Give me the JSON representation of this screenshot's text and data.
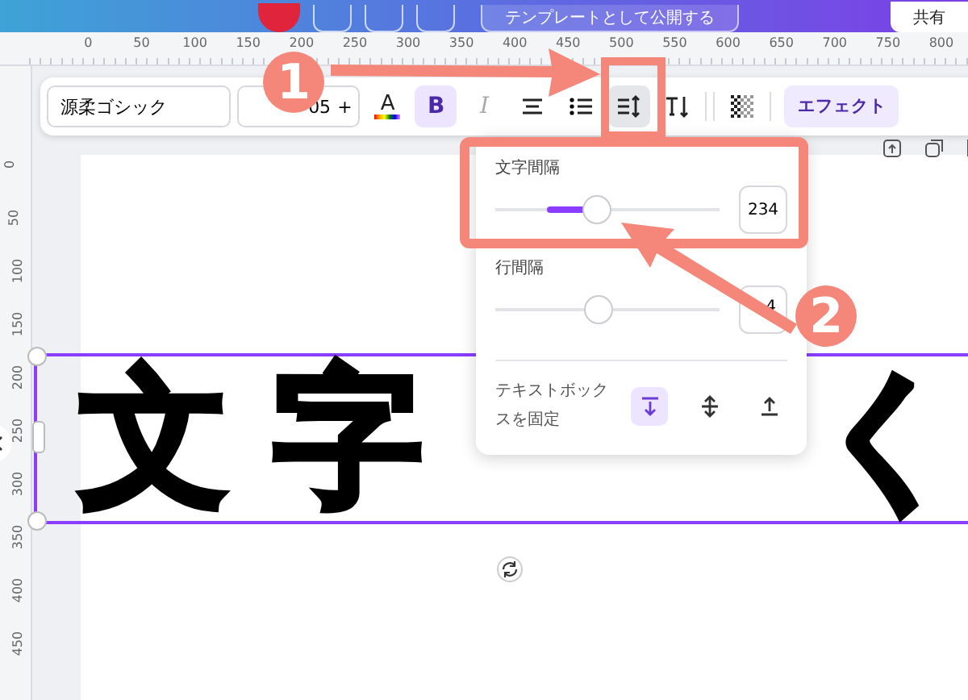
{
  "header": {
    "publish_button": "テンプレートとして公開する",
    "share_button": "共有"
  },
  "ruler": {
    "horizontal": [
      "0",
      "50",
      "100",
      "150",
      "200",
      "250",
      "300",
      "350",
      "400",
      "450",
      "500",
      "550",
      "600",
      "650",
      "700",
      "750",
      "800"
    ],
    "vertical": [
      "0",
      "50",
      "100",
      "150",
      "200",
      "250",
      "300",
      "350",
      "400",
      "450"
    ]
  },
  "toolbar": {
    "font": "源柔ゴシック",
    "font_size": "05",
    "size_plus": "+",
    "tools": [
      {
        "kind": "text-color",
        "label": "A",
        "selected": false
      },
      {
        "kind": "bold",
        "label": "B",
        "selected": true
      },
      {
        "kind": "italic",
        "label": "I",
        "selected": false
      },
      {
        "kind": "align",
        "selected": false
      },
      {
        "kind": "list",
        "selected": false
      },
      {
        "kind": "spacing",
        "selected": true
      },
      {
        "kind": "vertical",
        "selected": false
      },
      {
        "kind": "transparency",
        "selected": false
      }
    ],
    "effect_button": "エフェクト"
  },
  "spacing_panel": {
    "sliders": [
      {
        "label": "文字間隔",
        "level": 0.45,
        "changed": true,
        "value": "234"
      },
      {
        "label": "行間隔",
        "level": 0.46,
        "changed": false,
        "value": "4"
      }
    ],
    "anchor_label": "テキストボックスを固定",
    "anchors": [
      {
        "kind": "top",
        "selected": true
      },
      {
        "kind": "middle",
        "selected": false
      },
      {
        "kind": "bottom",
        "selected": false
      }
    ]
  },
  "canvas": {
    "texts": [
      "文字",
      "く"
    ]
  },
  "annotations": [
    {
      "number": "1"
    },
    {
      "number": "2"
    }
  ]
}
